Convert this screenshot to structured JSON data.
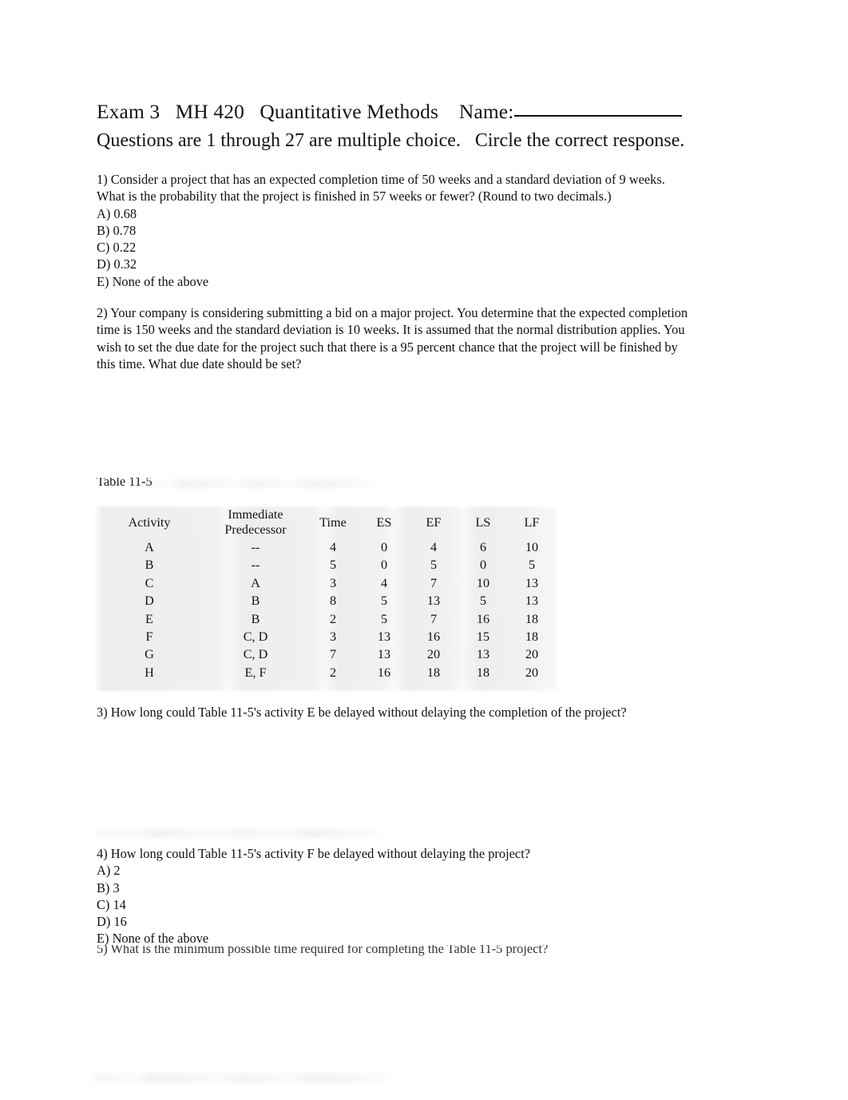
{
  "header": {
    "title_line": "Exam 3   MH 420   Quantitative Methods    Name:",
    "subtitle_line": "Questions are 1 through 27 are multiple choice.   Circle the correct response."
  },
  "questions": [
    {
      "id": "q1",
      "text": "1) Consider a project that has an expected completion time of 50 weeks and a standard deviation of 9 weeks. What is the probability that the project is finished in 57 weeks or fewer? (Round to two decimals.)",
      "options": [
        "A) 0.68",
        "B) 0.78",
        "C) 0.22",
        "D) 0.32",
        "E) None of the above"
      ]
    },
    {
      "id": "q2",
      "text": "2) Your company is considering submitting a bid on a major project. You determine that the expected completion time is 150 weeks and the standard deviation is 10 weeks. It is assumed that the normal distribution applies. You wish to set the due date for the project such that there is a 95 percent chance that the project will be finished by this time. What due date should be set?",
      "options": []
    },
    {
      "id": "q3",
      "text": "3) How long could Table 11-5's activity E be delayed without delaying the completion of the project?",
      "options": []
    },
    {
      "id": "q4",
      "text": "4) How long could Table 11-5's activity F be delayed without delaying the project?",
      "options": [
        "A) 2",
        "B) 3",
        "C) 14",
        "D) 16",
        "E) None of the above"
      ]
    },
    {
      "id": "q5",
      "text": "5) What is the minimum possible time required for completing the Table 11-5 project?",
      "options": []
    }
  ],
  "table": {
    "caption": "Table 11-5",
    "columns": [
      "Activity",
      "Immediate\nPredecessor",
      "Time",
      "ES",
      "EF",
      "LS",
      "LF"
    ],
    "rows": [
      [
        "A",
        "--",
        "4",
        "0",
        "4",
        "6",
        "10"
      ],
      [
        "B",
        "--",
        "5",
        "0",
        "5",
        "0",
        "5"
      ],
      [
        "C",
        "A",
        "3",
        "4",
        "7",
        "10",
        "13"
      ],
      [
        "D",
        "B",
        "8",
        "5",
        "13",
        "5",
        "13"
      ],
      [
        "E",
        "B",
        "2",
        "5",
        "7",
        "16",
        "18"
      ],
      [
        "F",
        "C, D",
        "3",
        "13",
        "16",
        "15",
        "18"
      ],
      [
        "G",
        "C, D",
        "7",
        "13",
        "20",
        "13",
        "20"
      ],
      [
        "H",
        "E, F",
        "2",
        "16",
        "18",
        "18",
        "20"
      ]
    ]
  }
}
